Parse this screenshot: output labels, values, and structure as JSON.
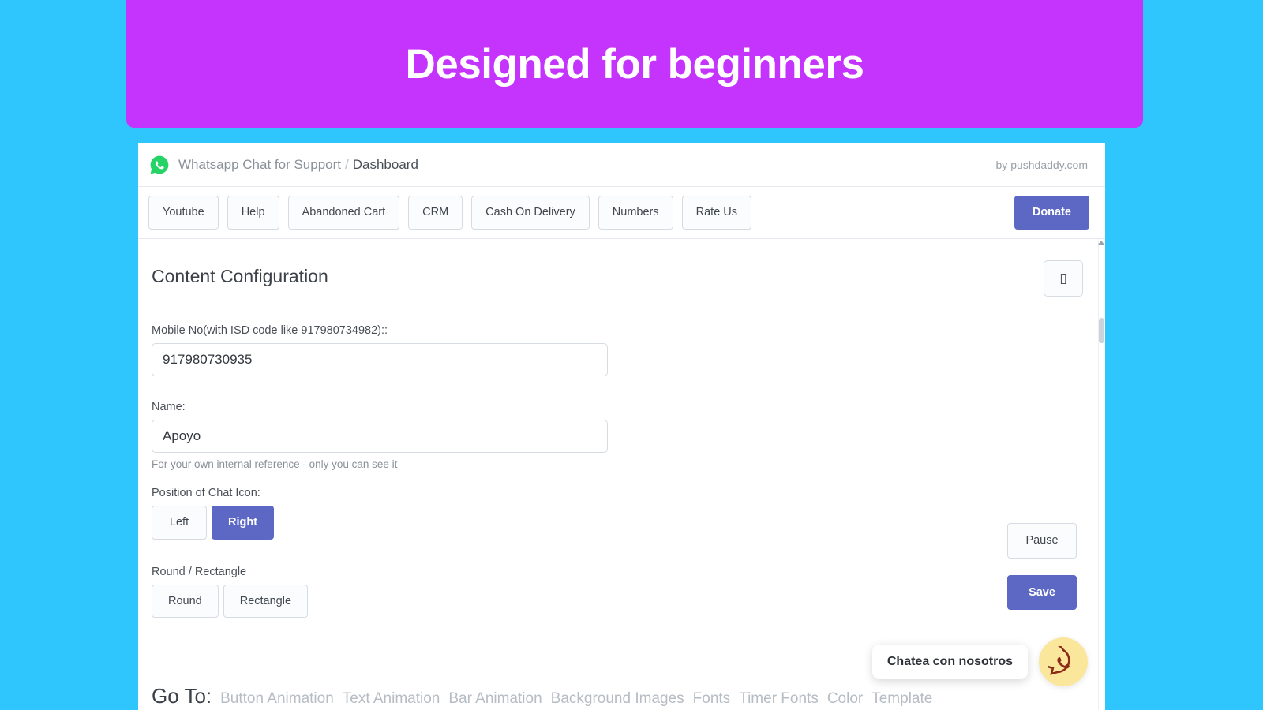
{
  "promo": {
    "headline": "Designed for beginners",
    "background_color": "#c434fc"
  },
  "page": {
    "background_color": "#2fc6fd",
    "accent_color": "#5c68c4",
    "whatsapp_green": "#25d366"
  },
  "app_header": {
    "brand_icon": "whatsapp-icon",
    "app_name": "Whatsapp Chat for Support",
    "separator": "/",
    "current_page": "Dashboard",
    "credit": "by pushdaddy.com"
  },
  "toolbar": {
    "buttons": [
      {
        "label": "Youtube"
      },
      {
        "label": "Help"
      },
      {
        "label": "Abandoned Cart"
      },
      {
        "label": "CRM"
      },
      {
        "label": "Cash On Delivery"
      },
      {
        "label": "Numbers"
      },
      {
        "label": "Rate Us"
      }
    ],
    "donate_label": "Donate"
  },
  "content": {
    "section_title": "Content Configuration",
    "header_icon_button": {
      "icon": "placeholder-box-icon",
      "glyph": "▯"
    },
    "fields": {
      "mobile": {
        "label": "Mobile No(with ISD code like 917980734982)::",
        "value": "917980730935",
        "placeholder": ""
      },
      "name": {
        "label": "Name:",
        "value": "Apoyo",
        "placeholder": "",
        "help": "For your own internal reference - only you can see it"
      },
      "position": {
        "label": "Position of Chat Icon:",
        "options": [
          "Left",
          "Right"
        ],
        "selected": "Right"
      },
      "shape": {
        "label": "Round / Rectangle",
        "options": [
          "Round",
          "Rectangle"
        ],
        "selected": ""
      }
    }
  },
  "side_actions": {
    "pause_label": "Pause",
    "save_label": "Save"
  },
  "goto": {
    "label": "Go To:",
    "links": [
      "Button Animation",
      "Text Animation",
      "Bar Animation",
      "Background Images",
      "Fonts",
      "Timer Fonts",
      "Color",
      "Template"
    ]
  },
  "chat_widget": {
    "bubble_text": "Chatea con nosotros",
    "fab_icon": "whatsapp-icon",
    "fab_color": "#fbe79b"
  }
}
